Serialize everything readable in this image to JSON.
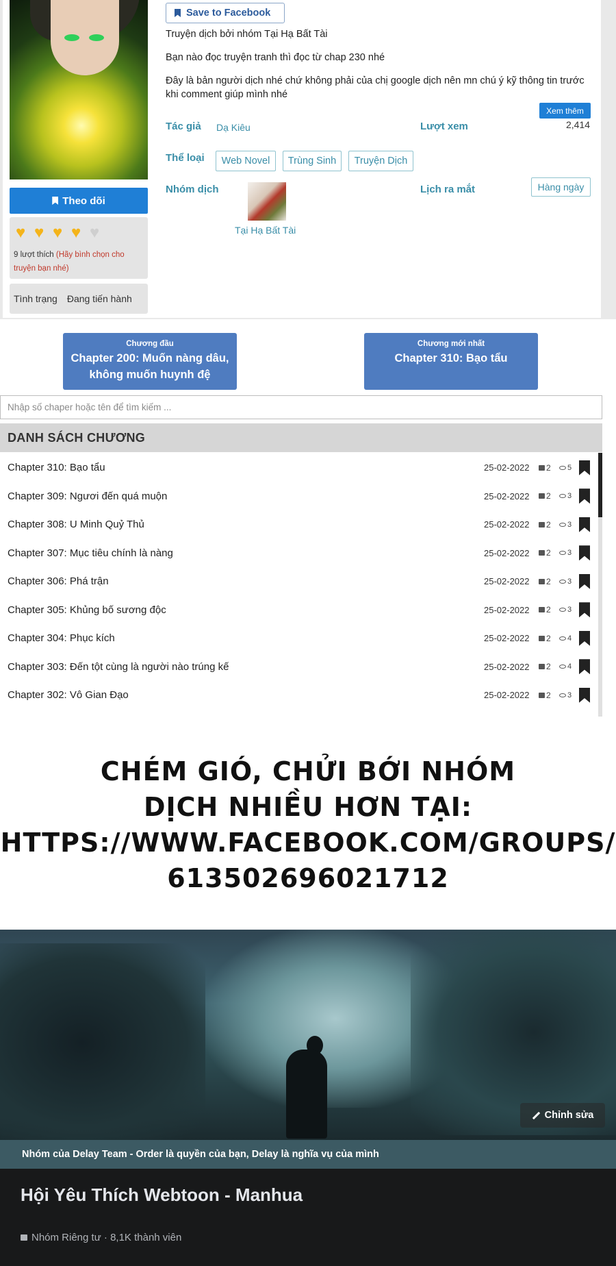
{
  "manga": {
    "save_facebook": "Save to Facebook",
    "follow_label": "Theo dõi",
    "likes_text": "9 lượt thích",
    "likes_hint": "(Hãy bình chọn cho truyện bạn nhé)",
    "rating": {
      "filled": 4,
      "total": 5
    },
    "status_label": "Tình trạng",
    "status_value": "Đang tiến hành",
    "description": [
      "Truyện dịch bởi nhóm Tại Hạ Bất Tài",
      "Bạn nào đọc truyện tranh thì đọc từ chap 230 nhé",
      "Đây là bản người dịch nhé chứ không phải của chị google dịch nên mn chú ý kỹ thông tin trước khi comment giúp mình nhé"
    ],
    "more_label": "Xem thêm",
    "author_label": "Tác giả",
    "author": "Dạ Kiêu",
    "views_label": "Lượt xem",
    "views": "2,414",
    "genre_label": "Thể loại",
    "genres": [
      "Web Novel",
      "Trùng Sinh",
      "Truyện Dịch"
    ],
    "group_label": "Nhóm dịch",
    "group_name": "Tại Hạ Bất Tài",
    "release_label": "Lịch ra mắt",
    "release_value": "Hàng ngày"
  },
  "nav": {
    "first_caption": "Chương đầu",
    "first_title": "Chapter 200: Muốn nàng dâu, không muốn huynh đệ",
    "latest_caption": "Chương mới nhất",
    "latest_title": "Chapter 310: Bạo tẩu"
  },
  "search": {
    "placeholder": "Nhập số chaper hoặc tên để tìm kiếm ..."
  },
  "chapter_list": {
    "heading": "DANH SÁCH CHƯƠNG",
    "rows": [
      {
        "title": "Chapter 310: Bạo tẩu",
        "date": "25-02-2022",
        "locks": "2",
        "views": "5"
      },
      {
        "title": "Chapter 309: Ngươi đến quá muộn",
        "date": "25-02-2022",
        "locks": "2",
        "views": "3"
      },
      {
        "title": "Chapter 308: U Minh Quỷ Thủ",
        "date": "25-02-2022",
        "locks": "2",
        "views": "3"
      },
      {
        "title": "Chapter 307: Mục tiêu chính là nàng",
        "date": "25-02-2022",
        "locks": "2",
        "views": "3"
      },
      {
        "title": "Chapter 306: Phá trận",
        "date": "25-02-2022",
        "locks": "2",
        "views": "3"
      },
      {
        "title": "Chapter 305: Khủng bố sương độc",
        "date": "25-02-2022",
        "locks": "2",
        "views": "3"
      },
      {
        "title": "Chapter 304: Phục kích",
        "date": "25-02-2022",
        "locks": "2",
        "views": "4"
      },
      {
        "title": "Chapter 303: Đến tột cùng là người nào trúng kế",
        "date": "25-02-2022",
        "locks": "2",
        "views": "4"
      },
      {
        "title": "Chapter 302: Vô Gian Đạo",
        "date": "25-02-2022",
        "locks": "2",
        "views": "3"
      }
    ]
  },
  "promo": {
    "lines": [
      "CHÉM GIÓ, CHỬI BỚI NHÓM",
      "DỊCH NHIỀU HƠN TẠI:",
      "HTTPS://WWW.FACEBOOK.COM/GROUPS/",
      "613502696021712"
    ]
  },
  "facebook": {
    "edit_label": "Chỉnh sửa",
    "strip_text": "Nhóm của Delay Team - Order là quyền của bạn, Delay là nghĩa vụ của mình",
    "group_title": "Hội Yêu Thích Webtoon - Manhua",
    "group_meta": "Nhóm Riêng tư · 8,1K thành viên"
  },
  "colors": {
    "accent": "#1f7fd6",
    "teal": "#3a8ea8",
    "nav_button": "#4f7cc0",
    "heart": "#f4b41a"
  }
}
